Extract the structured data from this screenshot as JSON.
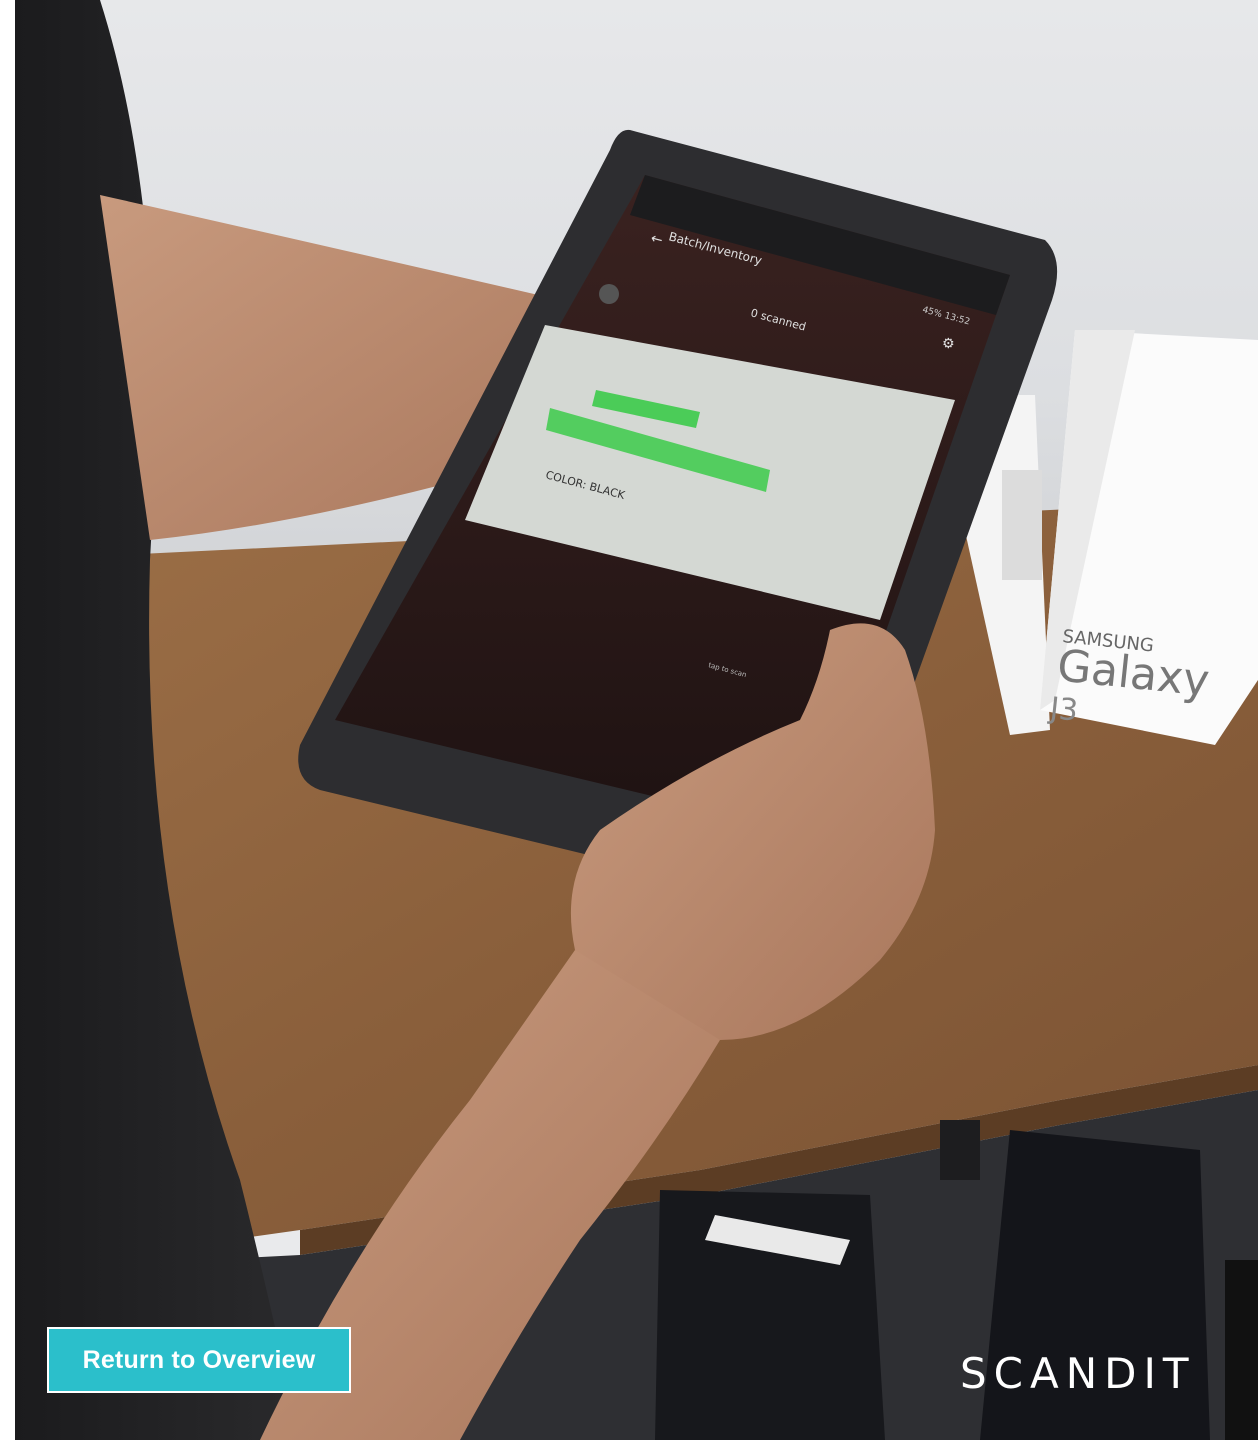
{
  "app": {
    "screen_title": "Batch/Inventory",
    "scanned_status": "0 scanned",
    "status_bar": "45% 13:52",
    "barcode_text_1": "COLOR: BLACK",
    "overlay_hint": "tap to scan"
  },
  "box": {
    "brand": "SAMSUNG",
    "product": "Galaxy",
    "model": "J3"
  },
  "overlay": {
    "return_label": "Return to Overview",
    "logo_text": "SCANDIT"
  },
  "colors": {
    "accent": "#2bbfcb",
    "scan_highlight": "#3ccb4a"
  },
  "icons": {
    "back": "back-arrow-icon",
    "settings": "gear-icon",
    "camera_toggle": "camera-icon"
  }
}
